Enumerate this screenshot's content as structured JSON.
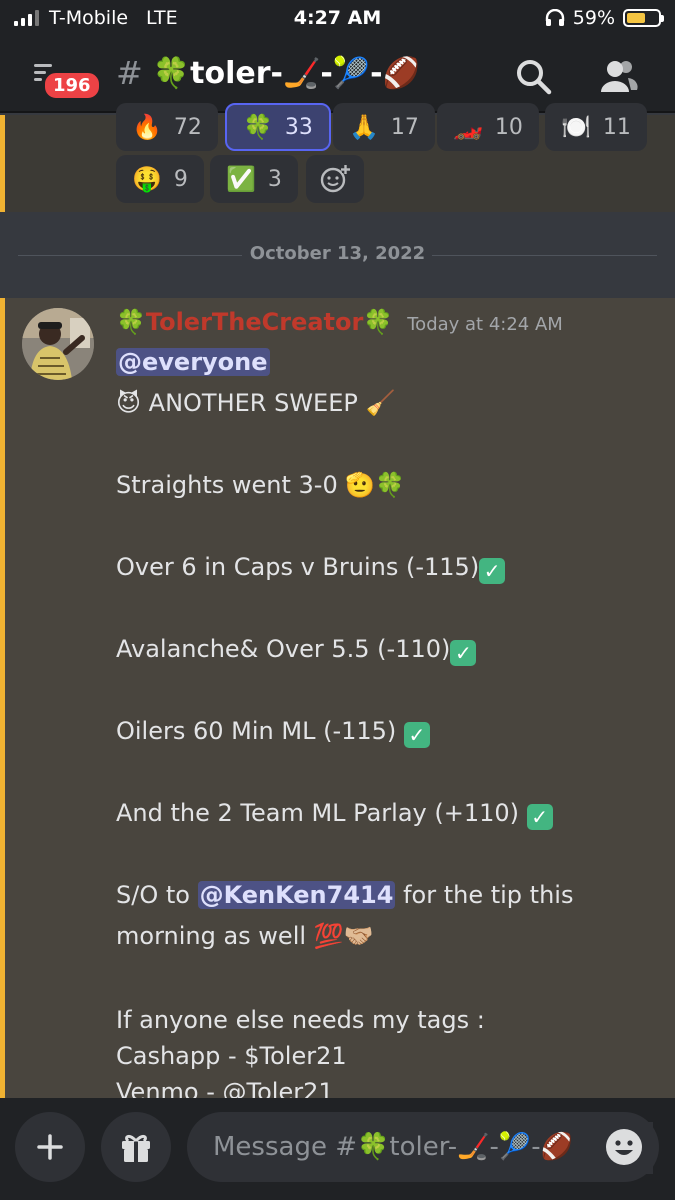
{
  "status_bar": {
    "carrier": "T-Mobile",
    "network": "LTE",
    "time": "4:27 AM",
    "battery": "59%",
    "battery_level": 0.59
  },
  "header": {
    "badge_count": "196",
    "channel_name": "🍀toler-🏒-🎾-🏈",
    "icons": [
      "menu-icon",
      "hash-icon",
      "search-icon",
      "members-icon"
    ]
  },
  "reactions": [
    {
      "emoji": "🔥",
      "count": "72"
    },
    {
      "emoji": "🍀",
      "count": "33",
      "active": true
    },
    {
      "emoji": "🙏",
      "count": "17"
    },
    {
      "emoji": "🏎️",
      "count": "10"
    },
    {
      "emoji": "🍽️",
      "count": "11"
    },
    {
      "emoji": "🤑",
      "count": "9"
    },
    {
      "emoji": "✅",
      "count": "3"
    }
  ],
  "add_reaction_icon": "add-reaction-icon",
  "date_divider": "October 13, 2022",
  "message": {
    "author": "TolerTheCreator",
    "author_decoration": "🍀",
    "timestamp": "Today at 4:24 AM",
    "mention_everyone": "@everyone",
    "line_sweep": "😈 ANOTHER SWEEP 🧹",
    "line_straights": "Straights went 3-0 🫡🍀",
    "line_caps": "Over 6 in Caps v Bruins (-115)",
    "line_avalanche": "Avalanche& Over 5.5 (-110)",
    "line_oilers": "Oilers 60 Min ML (-115) ",
    "line_parlay": "And the 2 Team ML Parlay (+110) ",
    "shoutout_prefix": "S/O to ",
    "shoutout_mention": "@KenKen7414",
    "shoutout_suffix": " for the tip this",
    "shoutout_line2": "morning as well 💯🤝🏼",
    "tags_intro": "If anyone else needs my tags :",
    "cashapp": "Cashapp - $Toler21",
    "venmo": "Venmo - @Toler21",
    "check_mark": "✓"
  },
  "composer": {
    "placeholder": "Message #🍀toler-🏒-🎾-🏈"
  },
  "colors": {
    "accent": "#5865f2",
    "author": "#c0392b",
    "mention_bg": "#4d5285",
    "strip": "#f0b232"
  }
}
